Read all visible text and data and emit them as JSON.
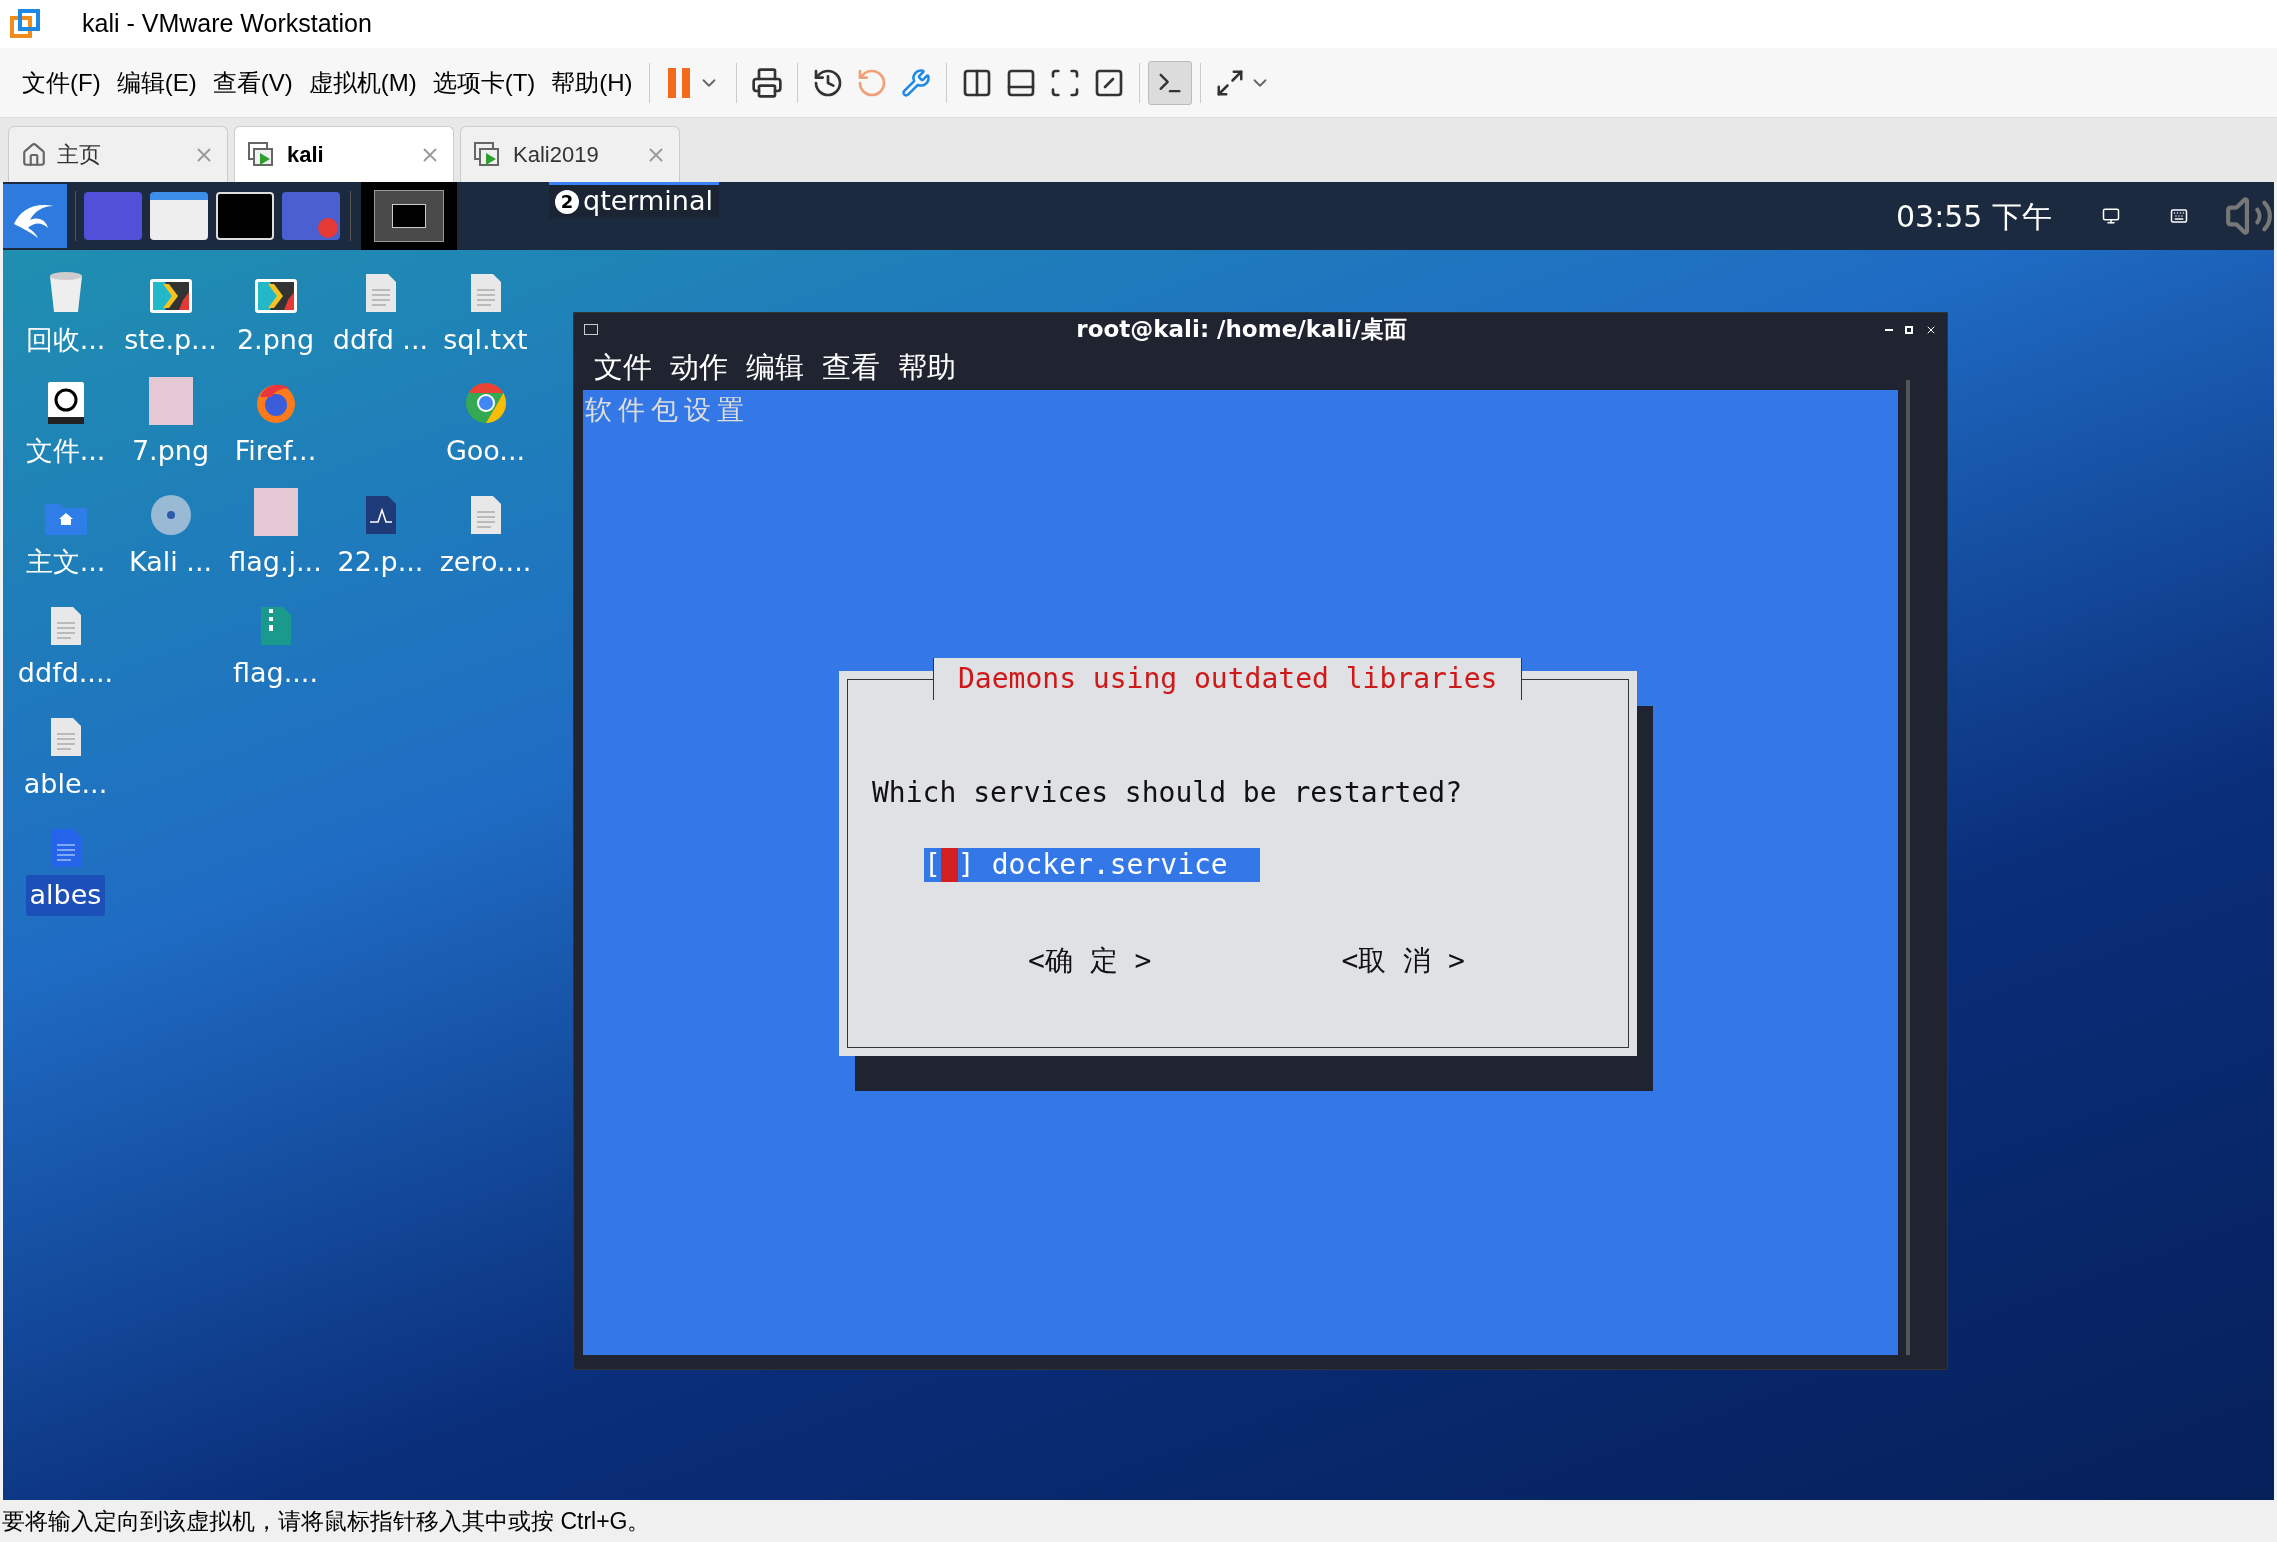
{
  "window": {
    "title": "kali - VMware Workstation"
  },
  "menu": [
    "文件(F)",
    "编辑(E)",
    "查看(V)",
    "虚拟机(M)",
    "选项卡(T)",
    "帮助(H)"
  ],
  "tabs": [
    {
      "label": "主页",
      "kind": "home",
      "selected": false
    },
    {
      "label": "kali",
      "kind": "vm",
      "selected": true
    },
    {
      "label": "Kali2019",
      "kind": "vm",
      "selected": false
    }
  ],
  "panel": {
    "task": {
      "badge": "2",
      "label": "qterminal"
    },
    "clock": "03:55 下午"
  },
  "desktop_icons": [
    {
      "label": "回收...",
      "kind": "trash",
      "selected": false
    },
    {
      "label": "ste.p...",
      "kind": "app",
      "selected": false
    },
    {
      "label": "2.png",
      "kind": "app",
      "selected": false
    },
    {
      "label": "ddfd ...",
      "kind": "text",
      "selected": false
    },
    {
      "label": "sql.txt",
      "kind": "text",
      "selected": false
    },
    {
      "label": "文件...",
      "kind": "disk",
      "selected": false
    },
    {
      "label": "7.png",
      "kind": "photo",
      "selected": false
    },
    {
      "label": "Firef...",
      "kind": "firefox",
      "selected": false
    },
    {
      "label": "Goo...",
      "kind": "chrome",
      "selected": false
    },
    {
      "label": "主文...",
      "kind": "home",
      "selected": false
    },
    {
      "label": "Kali ...",
      "kind": "disc",
      "selected": false
    },
    {
      "label": "flag.j...",
      "kind": "photo",
      "selected": false
    },
    {
      "label": "22.p...",
      "kind": "chart",
      "selected": false
    },
    {
      "label": "zero....",
      "kind": "text",
      "selected": false
    },
    {
      "label": "ddfd....",
      "kind": "text",
      "selected": false
    },
    {
      "label": "flag....",
      "kind": "archive",
      "selected": false
    },
    {
      "label": "able...",
      "kind": "text",
      "selected": false
    },
    {
      "label": "albes",
      "kind": "document",
      "selected": true
    }
  ],
  "terminal": {
    "title": "root@kali: /home/kali/桌面",
    "menu": [
      "文件",
      "动作",
      "编辑",
      "查看",
      "帮助"
    ],
    "header": "软件包设置",
    "dialog": {
      "title": "Daemons using outdated libraries",
      "question": "Which services should be restarted?",
      "options": [
        {
          "open": "[",
          "close": "]",
          "label": "docker.service",
          "checked": false,
          "selected": true
        }
      ],
      "buttons": [
        "<确 定 >",
        "<取 消 >"
      ]
    }
  },
  "status_bar": "要将输入定向到该虚拟机，请将鼠标指针移入其中或按 Ctrl+G。"
}
